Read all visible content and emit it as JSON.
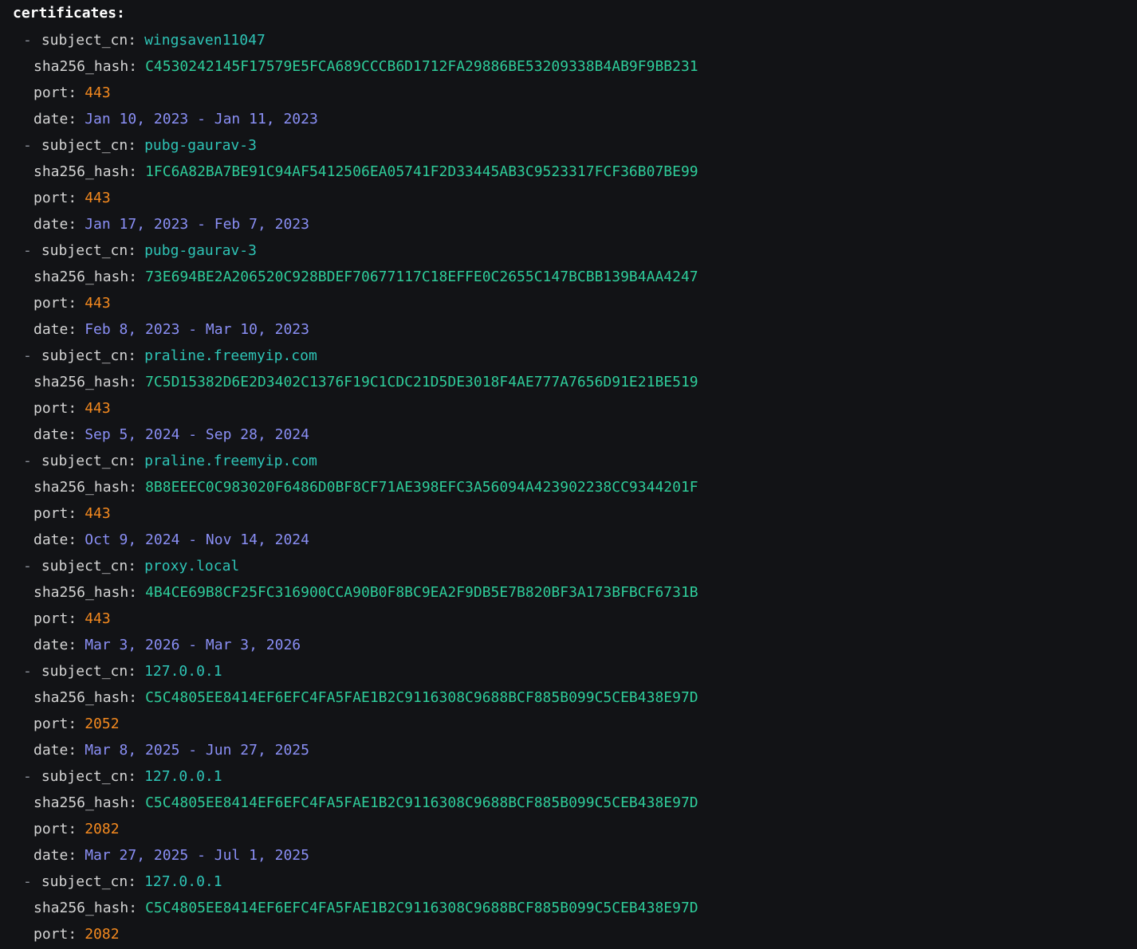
{
  "root_key": "certificates",
  "labels": {
    "dash": "-",
    "subject_cn": "subject_cn",
    "sha256_hash": "sha256_hash",
    "port": "port",
    "date": "date",
    "colon": ":"
  },
  "certificates": [
    {
      "subject_cn": "wingsaven11047",
      "sha256_hash": "C4530242145F17579E5FCA689CCCB6D1712FA29886BE53209338B4AB9F9BB231",
      "port": "443",
      "date": "Jan 10, 2023 - Jan 11, 2023"
    },
    {
      "subject_cn": "pubg-gaurav-3",
      "sha256_hash": "1FC6A82BA7BE91C94AF5412506EA05741F2D33445AB3C9523317FCF36B07BE99",
      "port": "443",
      "date": "Jan 17, 2023 - Feb 7, 2023"
    },
    {
      "subject_cn": "pubg-gaurav-3",
      "sha256_hash": "73E694BE2A206520C928BDEF70677117C18EFFE0C2655C147BCBB139B4AA4247",
      "port": "443",
      "date": "Feb 8, 2023 - Mar 10, 2023"
    },
    {
      "subject_cn": "praline.freemyip.com",
      "sha256_hash": "7C5D15382D6E2D3402C1376F19C1CDC21D5DE3018F4AE777A7656D91E21BE519",
      "port": "443",
      "date": "Sep 5, 2024 - Sep 28, 2024"
    },
    {
      "subject_cn": "praline.freemyip.com",
      "sha256_hash": "8B8EEEC0C983020F6486D0BF8CF71AE398EFC3A56094A423902238CC9344201F",
      "port": "443",
      "date": "Oct 9, 2024 - Nov 14, 2024"
    },
    {
      "subject_cn": "proxy.local",
      "sha256_hash": "4B4CE69B8CF25FC316900CCA90B0F8BC9EA2F9DB5E7B820BF3A173BFBCF6731B",
      "port": "443",
      "date": "Mar 3, 2026 - Mar 3, 2026"
    },
    {
      "subject_cn": "127.0.0.1",
      "sha256_hash": "C5C4805EE8414EF6EFC4FA5FAE1B2C9116308C9688BCF885B099C5CEB438E97D",
      "port": "2052",
      "date": "Mar 8, 2025 - Jun 27, 2025"
    },
    {
      "subject_cn": "127.0.0.1",
      "sha256_hash": "C5C4805EE8414EF6EFC4FA5FAE1B2C9116308C9688BCF885B099C5CEB438E97D",
      "port": "2082",
      "date": "Mar 27, 2025 - Jul 1, 2025"
    },
    {
      "subject_cn": "127.0.0.1",
      "sha256_hash": "C5C4805EE8414EF6EFC4FA5FAE1B2C9116308C9688BCF885B099C5CEB438E97D",
      "port": "2082"
    }
  ],
  "colors": {
    "background": "#121316",
    "subject_cn_value": "#2ec4b6",
    "hash_value": "#2ecc9a",
    "port_value": "#f58a1f",
    "date_value": "#8a8ff5"
  }
}
